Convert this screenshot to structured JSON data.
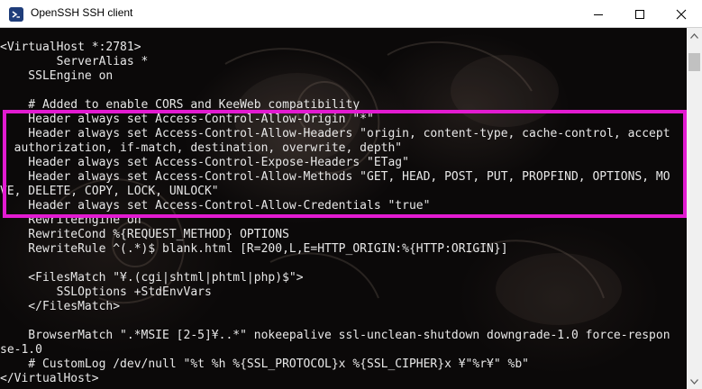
{
  "window": {
    "title": "OpenSSH SSH client",
    "icon": "powershell-icon",
    "controls": {
      "minimize": "minimize-icon",
      "maximize": "maximize-icon",
      "close": "close-icon"
    }
  },
  "console": {
    "lines": [
      "<VirtualHost *:2781>",
      "        ServerAlias *",
      "    SSLEngine on",
      "",
      "    # Added to enable CORS and KeeWeb compatibility",
      "    Header always set Access-Control-Allow-Origin \"*\"",
      "    Header always set Access-Control-Allow-Headers \"origin, content-type, cache-control, accept",
      "  authorization, if-match, destination, overwrite, depth\"",
      "    Header always set Access-Control-Expose-Headers \"ETag\"",
      "    Header always set Access-Control-Allow-Methods \"GET, HEAD, POST, PUT, PROPFIND, OPTIONS, MO",
      "VE, DELETE, COPY, LOCK, UNLOCK\"",
      "    Header always set Access-Control-Allow-Credentials \"true\"",
      "    RewriteEngine on",
      "    RewriteCond %{REQUEST_METHOD} OPTIONS",
      "    RewriteRule ^(.*)$ blank.html [R=200,L,E=HTTP_ORIGIN:%{HTTP:ORIGIN}]",
      "",
      "    <FilesMatch \"¥.(cgi|shtml|phtml|php)$\">",
      "        SSLOptions +StdEnvVars",
      "    </FilesMatch>",
      "",
      "    BrowserMatch \".*MSIE [2-5]¥..*\" nokeepalive ssl-unclean-shutdown downgrade-1.0 force-respon",
      "se-1.0",
      "    # CustomLog /dev/null \"%t %h %{SSL_PROTOCOL}x %{SSL_CIPHER}x ¥\"%r¥\" %b\"",
      "</VirtualHost>"
    ]
  },
  "highlight": {
    "color": "#e21bd1"
  },
  "scrollbar": {
    "up_icon": "scroll-up-arrow-icon",
    "down_icon": "scroll-down-arrow-icon"
  }
}
